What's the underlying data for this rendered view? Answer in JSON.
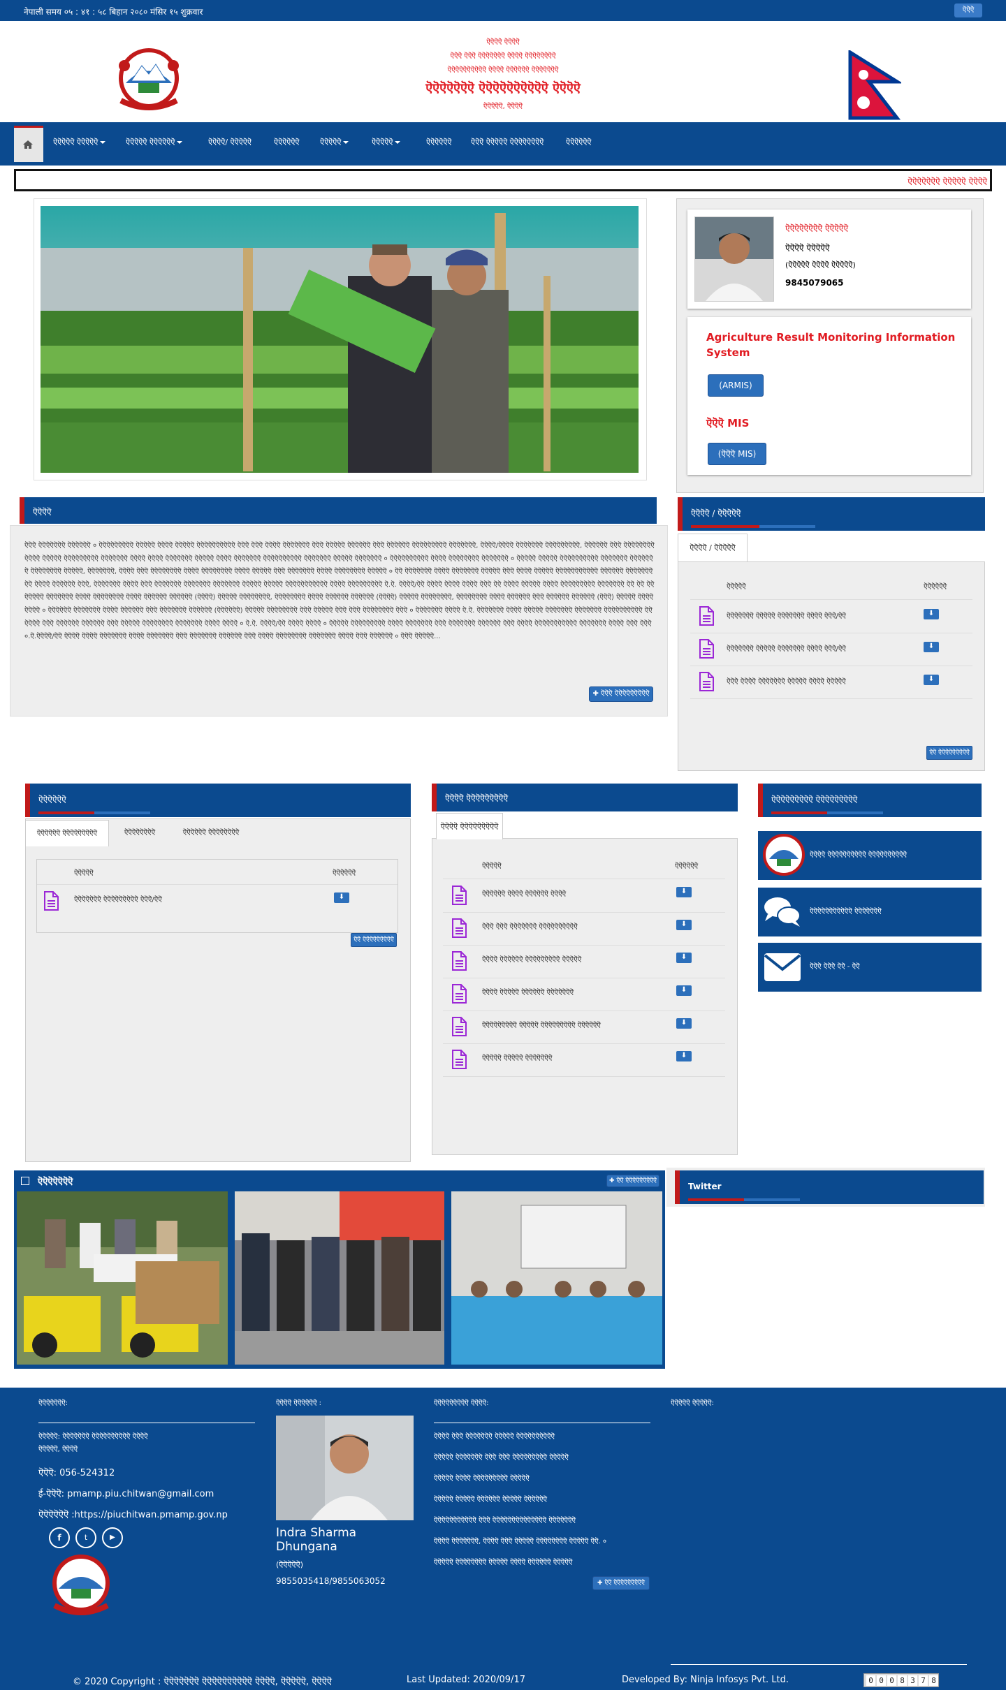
{
  "topbar": {
    "time": "नेपाली समय ०५ : ४१ : ५८ बिहान  २०८० मंसिर १५ शुक्रवार",
    "lang_button": "ऎऎऎ"
  },
  "header": {
    "line1": "ऎऎऎऎ ऎऎऎऎ",
    "line2": "ऎऎऎ ऎऎऎ ऎऎऎऎऎऎऎ ऎऎऎऎ ऎऎऎऎऎऎऎऎ",
    "line3": "ऎऎऎऎऎऎऎऎऎऎ ऎऎऎऎ ऎऎऎऎऎऎ ऎऎऎऎऎऎऎ",
    "title": "ऎऎऎऎऎऎऎ ऎऎऎऎऎऎऎऎऎऎ ऎऎऎऎ",
    "location": "ऎऎऎऎऎ, ऎऎऎऎ"
  },
  "nav": {
    "items": [
      {
        "label": "ऎऎऎऎऎ ऎऎऎऎऎ",
        "dropdown": true
      },
      {
        "label": "ऎऎऎऎऎ ऎऎऎऎऎऎ",
        "dropdown": true
      },
      {
        "label": "ऎऎऎऎ/ ऎऎऎऎऎ",
        "dropdown": false
      },
      {
        "label": "ऎऎऎऎऎऎ",
        "dropdown": false
      },
      {
        "label": "ऎऎऎऎऎ",
        "dropdown": true
      },
      {
        "label": "ऎऎऎऎऎ",
        "dropdown": true
      },
      {
        "label": "ऎऎऎऎऎऎ",
        "dropdown": false
      },
      {
        "label": "ऎऎऎ ऎऎऎऎऎ ऎऎऎऎऎऎऎऎ",
        "dropdown": false
      },
      {
        "label": "ऎऎऎऎऎऎ",
        "dropdown": false
      }
    ]
  },
  "marquee": "ऎऎऎऎऎऎऎ ऎऎऎऎऎ ऎऎऎऎ",
  "officer": {
    "role": "ऎऎऎऎऎऎऎऎ ऎऎऎऎऎ",
    "name": "ऎऎऎऎ ऎऎऎऎऎ",
    "designation": "(ऎऎऎऎऎ ऎऎऎऎ ऎऎऎऎऎ)",
    "phone": "9845079065"
  },
  "systems": {
    "armis_title": "Agriculture Result Monitoring Information System",
    "armis_button": "(ARMIS)",
    "mis_title": "ऎऎऎ MIS",
    "mis_button": "(ऎऎऎ MIS)"
  },
  "about": {
    "title": "ऎऎऎऎ",
    "body": "ऎऎऎ ऎऎऎऎऎऎऎ ऎऎऎऎऎऎ ० ऎऎऎऎऎऎऎऎऎ ऎऎऎऎऎ ऎऎऎऎ ऎऎऎऎऎ ऎऎऎऎऎऎऎऎऎऎ ऎऎऎ ऎऎऎ ऎऎऎऎ ऎऎऎऎऎऎऎ ऎऎऎ ऎऎऎऎऎ ऎऎऎऎऎऎ ऎऎऎ ऎऎऎऎऎऎ ऎऎऎऎऎऎऎऎऎ ऎऎऎऎऎऎऎ, ऎऎऎऎ/ऎऎऎऎ ऎऎऎऎऎऎऎ ऎऎऎऎऎऎऎऎऎ, ऎऎऎऎऎऎ ऎऎऎ ऎऎऎऎऎऎऎऎ ऎऎऎऎ ऎऎऎऎऎ ऎऎऎऎऎऎऎऎऎ ऎऎऎऎऎऎऎ ऎऎऎऎ ऎऎऎऎ ऎऎऎऎऎऎऎ ऎऎऎऎऎ ऎऎऎऎ ऎऎऎऎऎऎऎ ऎऎऎऎऎऎऎऎऎऎ ऎऎऎऎऎऎऎ ऎऎऎऎऎ ऎऎऎऎऎऎऎ ० ऎऎऎऎऎऎऎऎऎऎ ऎऎऎऎ ऎऎऎऎऎऎऎऎ ऎऎऎऎऎऎऎ ० ऎऎऎऎऎ ऎऎऎऎऎ ऎऎऎऎऎऎऎऎऎऎ ऎऎऎऎऎऎऎ ऎऎऎऎऎऎऎ ऎऎऎऎऎऎऎऎ ऎऎऎऎऎ, ऎऎऎऎऎऎऎ, ऎऎऎऎ ऎऎऎ ऎऎऎऎऎऎऎऎ ऎऎऎऎ ऎऎऎऎऎऎऎऎ ऎऎऎऎ ऎऎऎऎऎ ऎऎऎ ऎऎऎऎऎऎऎ ऎऎऎऎ ऎऎऎऎऎऎऎऎ ऎऎऎऎऎ ० ऎऎ ऎऎऎऎऎऎऎ ऎऎऎऎ ऎऎऎऎऎऎऎ ऎऎऎऎऎ ऎऎऎ ऎऎऎऎ ऎऎऎऎऎ ऎऎऎऎऎऎऎऎऎऎऎ ऎऎऎऎऎऎ ऎऎऎऎऎऎऎऎऎ ऎऎऎऎ ऎऎऎऎऎऎ ऎऎऎ, ऎऎऎऎऎऎऎ ऎऎऎऎ ऎऎऎ ऎऎऎऎऎऎऎ ऎऎऎऎऎऎऎ ऎऎऎऎऎऎऎ ऎऎऎऎऎ ऎऎऎऎऎ ऎऎऎऎऎऎऎऎऎऎऎ ऎऎऎऎ ऎऎऎऎऎऎऎऎऎ ऎ.ऎ. ऎऎऎऎ/ऎऎ ऎऎऎऎ ऎऎऎऎ ऎऎऎऎ ऎऎऎ ऎऎ ऎऎऎऎ ऎऎऎऎऎ ऎऎऎऎ ऎऎऎऎऎऎऎऎऎ ऎऎऎऎऎऎऎ ऎऎ ऎऎ ऎऎऎऎऎऎऎ ऎऎऎऎऎऎऎ ऎऎऎऎ ऎऎऎऎऎऎऎऎ ऎऎऎऎ ऎऎऎऎऎऎ ऎऎऎऎऎऎ (ऎऎऎऎ) ऎऎऎऎऎ ऎऎऎऎऎऎऎऎ, ऎऎऎऎऎऎऎऎ ऎऎऎऎ ऎऎऎऎऎऎ ऎऎऎऎऎऎ (ऎऎऎऎ) ऎऎऎऎऎ ऎऎऎऎऎऎऎऎ, ऎऎऎऎऎऎऎऎ ऎऎऎऎ ऎऎऎऎऎऎ ऎऎऎ ऎऎऎऎऎऎ ऎऎऎऎऎऎ (ऎऎऎ) ऎऎऎऎऎ ऎऎऎऎऎऎऎऎ ० ऎऎऎऎऎऎ ऎऎऎऎऎऎऎ ऎऎऎऎ ऎऎऎऎऎऎ ऎऎऎ ऎऎऎऎऎऎऎ ऎऎऎऎऎऎ (ऎऎऎऎऎऎ) ऎऎऎऎऎ ऎऎऎऎऎऎऎऎ ऎऎऎ ऎऎऎऎऎ ऎऎऎ ऎऎऎ ऎऎऎऎऎऎऎऎ ऎऎऎ ० ऎऎऎऎऎऎऎ ऎऎऎऎ ऎ.ऎ. ऎऎऎऎऎऎऎ ऎऎऎऎ ऎऎऎऎऎ ऎऎऎऎऎऎऎ ऎऎऎऎऎऎऎ ऎऎऎऎऎऎऎऎऎऎ ऎऎऎऎऎऎ ऎऎऎ ऎऎऎऎऎऎ ऎऎऎऎऎऎ ऎऎऎ ऎऎऎऎऎ ऎऎऎऎऎऎऎऎ ऎऎऎऎऎऎऎ ऎऎऎऎ ऎऎऎऎ ० ऎ.ऎ. ऎऎऎऎ/ऎऎ ऎऎऎऎ ऎऎऎऎ ० ऎऎऎऎऎ ऎऎऎऎऎऎऎऎऎ ऎऎऎऎ ऎऎऎऎऎऎऎ ऎऎऎ ऎऎऎऎऎऎऎ ऎऎऎऎऎऎ ऎऎऎ ऎऎऎऎ ऎऎऎऎऎऎऎऎऎऎऎ ऎऎऎऎऎऎऎ ऎऎऎऎ ऎऎऎ ऎऎऎ ०.ऎ.ऎऎऎऎ/ऎऎ ऎऎऎऎ ऎऎऎऎ ऎऎऎऎऎऎऎ ऎऎऎऎ ऎऎऎऎऎऎऎ ऎऎऎ ऎऎऎऎऎऎऎ ऎऎऎऎऎऎ ऎऎऎ ऎऎऎऎ ऎऎऎऎऎऎऎऎ ऎऎऎऎऎऎऎ ऎऎऎऎ ऎऎऎ ऎऎऎऎऎऎ ० ऎऎऎ ऎऎऎऎऎ...",
    "more": "ऎऎऎ ऎऎऎऎऎऎऎऎऎ"
  },
  "notices": {
    "title": "ऎऎऎऎ / ऎऎऎऎऎ",
    "tab": "ऎऎऎऎ / ऎऎऎऎऎ",
    "col_title": "ऎऎऎऎऎ",
    "col_download": "ऎऎऎऎऎऎ",
    "rows": [
      "ऎऎऎऎऎऎऎ ऎऎऎऎऎ ऎऎऎऎऎऎऎ ऎऎऎऎ ऎऎऎ/ऎऎ",
      "ऎऎऎऎऎऎऎ ऎऎऎऎऎ ऎऎऎऎऎऎऎ ऎऎऎऎ ऎऎऎ/ऎऎ",
      "ऎऎऎ ऎऎऎऎ ऎऎऎऎऎऎऎ ऎऎऎऎऎ ऎऎऎऎ ऎऎऎऎऎ"
    ],
    "all": "ऎऎ ऎऎऎऎऎऎऎऎऎ"
  },
  "reports": {
    "title": "ऎऎऎऎऎऎ",
    "tabs": [
      "ऎऎऎऎऎऎ ऎऎऎऎऎऎऎऎऎ",
      "ऎऎऎऎऎऎऎऎ",
      "ऎऎऎऎऎऎ ऎऎऎऎऎऎऎऎ"
    ],
    "col_title": "ऎऎऎऎऎ",
    "col_download": "ऎऎऎऎऎऎ",
    "rows": [
      "ऎऎऎऎऎऎऎ ऎऎऎऎऎऎऎऎऎ ऎऎऎ/ऎऎ"
    ],
    "all": "ऎऎ ऎऎऎऎऎऎऎऎऎ"
  },
  "publications": {
    "title": "ऎऎऎऎ ऎऎऎऎऎऎऎऎऎ",
    "tab": "ऎऎऎऎ ऎऎऎऎऎऎऎऎऎ",
    "col_title": "ऎऎऎऎऎ",
    "col_download": "ऎऎऎऎऎऎ",
    "rows": [
      "ऎऎऎऎऎऎ ऎऎऎऎ ऎऎऎऎऎऎ ऎऎऎऎ",
      "ऎऎऎ ऎऎऎ ऎऎऎऎऎऎऎ ऎऎऎऎऎऎऎऎऎऎ",
      "ऎऎऎऎ ऎऎऎऎऎऎ ऎऎऎऎऎऎऎऎऎ ऎऎऎऎऎ",
      "ऎऎऎऎ ऎऎऎऎऎ ऎऎऎऎऎऎ ऎऎऎऎऎऎऎ",
      "ऎऎऎऎऎऎऎऎऎ ऎऎऎऎऎ ऎऎऎऎऎऎऎऎऎ ऎऎऎऎऎऎ",
      "ऎऎऎऎऎ ऎऎऎऎऎ ऎऎऎऎऎऎऎ"
    ]
  },
  "quicklinks": {
    "title": "ऎऎऎऎऎऎऎऎऎ ऎऎऎऎऎऎऎऎऎ",
    "items": [
      {
        "label": "ऎऎऎऎ ऎऎऎऎऎऎऎऎऎऎ ऎऎऎऎऎऎऎऎऎऎ",
        "icon": "emblem-icon"
      },
      {
        "label": "ऎऎऎऎऎऎऎऎऎऎऎ ऎऎऎऎऎऎऎ",
        "icon": "comments-icon"
      },
      {
        "label": "ऎऎऎ ऎऎऎ ऎऎ - ऎऎ",
        "icon": "envelope-icon"
      }
    ]
  },
  "gallery": {
    "title": "ऎऎऎऎऎऎऎ",
    "more": "ऎऎ ऎऎऎऎऎऎऎऎऎ"
  },
  "twitter": {
    "title": "Twitter"
  },
  "footer": {
    "contact_title": "ऎऎऎऎऎऎऎ:",
    "address": "ऎऎऎऎऎ: ऎऎऎऎऎऎऎ ऎऎऎऎऎऎऎऎऎऎ ऎऎऎऎ",
    "address2": "ऎऎऎऎऎ, ऎऎऎऎ",
    "phone": "ऎऎऎ: 056-524312",
    "email": "ई-ऎऎऎ: pmamp.piu.chitwan@gmail.com",
    "website": "ऎऎऎऎऎऎ :https://piuchitwan.pmamp.gov.np",
    "info_title": "ऎऎऎऎ ऎऎऎऎऎऎ :",
    "info_name": "Indra Sharma Dhungana",
    "info_role": "(ऎऎऎऎऎ)",
    "info_phone": "9855035418/9855063052",
    "links_title": "ऎऎऎऎऎऎऎऎऎ ऎऎऎऎ:",
    "links": [
      "ऎऎऎऎ ऎऎऎ ऎऎऎऎऎऎऎ ऎऎऎऎऎ ऎऎऎऎऎऎऎऎऎऎ",
      "ऎऎऎऎऎ ऎऎऎऎऎऎऎ ऎऎऎ ऎऎऎ ऎऎऎऎऎऎऎऎऎ ऎऎऎऎऎ",
      "ऎऎऎऎऎ ऎऎऎऎ ऎऎऎऎऎऎऎऎऎ ऎऎऎऎऎ",
      "ऎऎऎऎऎ ऎऎऎऎऎ ऎऎऎऎऎऎ ऎऎऎऎऎ ऎऎऎऎऎऎ",
      "ऎऎऎऎऎऎऎऎऎऎऎ ऎऎऎ ऎऎऎऎऎऎऎऎऎऎऎऎऎऎ ऎऎऎऎऎऎऎ",
      "ऎऎऎऎ ऎऎऎऎऎऎऎ, ऎऎऎऎ ऎऎऎ ऎऎऎऎऎ ऎऎऎऎऎऎऎऎ ऎऎऎऎऎ ऎऎ. ०",
      "ऎऎऎऎऎ ऎऎऎऎऎऎऎऎ ऎऎऎऎऎ ऎऎऎऎ ऎऎऎऎऎऎ ऎऎऎऎऎ"
    ],
    "links_more": "ऎऎ ऎऎऎऎऎऎऎऎऎ",
    "visits_title": "ऎऎऎऎऎ ऎऎऎऎऎ:",
    "copyright": "© 2020 Copyright : ऎऎऎऎऎऎऎ ऎऎऎऎऎऎऎऎऎऎ ऎऎऎऎ, ऎऎऎऎऎ, ऎऎऎऎ",
    "updated": "Last Updated: 2020/09/17",
    "developer": "Developed By: Ninja Infosys Pvt. Ltd.",
    "counter": [
      "0",
      "0",
      "0",
      "8",
      "3",
      "7",
      "8"
    ]
  }
}
